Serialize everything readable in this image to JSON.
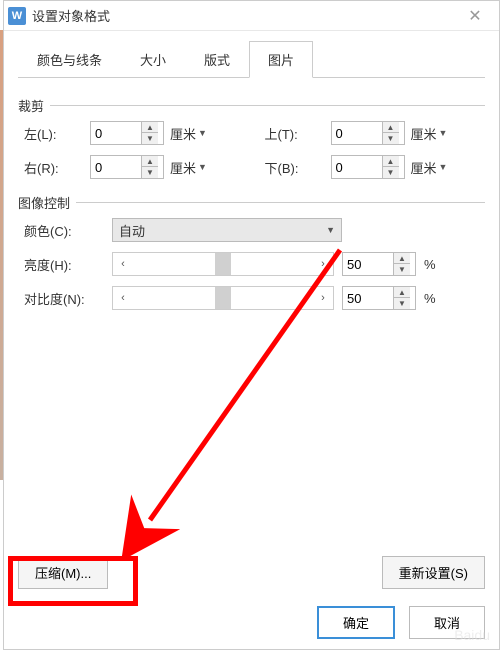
{
  "titlebar": {
    "title": "设置对象格式",
    "close": "✕"
  },
  "tabs": {
    "colors": "颜色与线条",
    "size": "大小",
    "layout": "版式",
    "picture": "图片"
  },
  "activeTab": "picture",
  "crop": {
    "header": "裁剪",
    "left_label": "左(L):",
    "right_label": "右(R):",
    "top_label": "上(T):",
    "bottom_label": "下(B):",
    "left_val": "0",
    "right_val": "0",
    "top_val": "0",
    "bottom_val": "0",
    "unit": "厘米"
  },
  "imgctrl": {
    "header": "图像控制",
    "color_label": "颜色(C):",
    "color_value": "自动",
    "brightness_label": "亮度(H):",
    "brightness_val": "50",
    "contrast_label": "对比度(N):",
    "contrast_val": "50",
    "percent": "%"
  },
  "buttons": {
    "compress": "压缩(M)...",
    "reset": "重新设置(S)",
    "ok": "确定",
    "cancel": "取消"
  },
  "icons": {
    "up": "▲",
    "down": "▼",
    "left": "‹",
    "right": "›",
    "app": "W"
  },
  "watermark": "Baidu"
}
